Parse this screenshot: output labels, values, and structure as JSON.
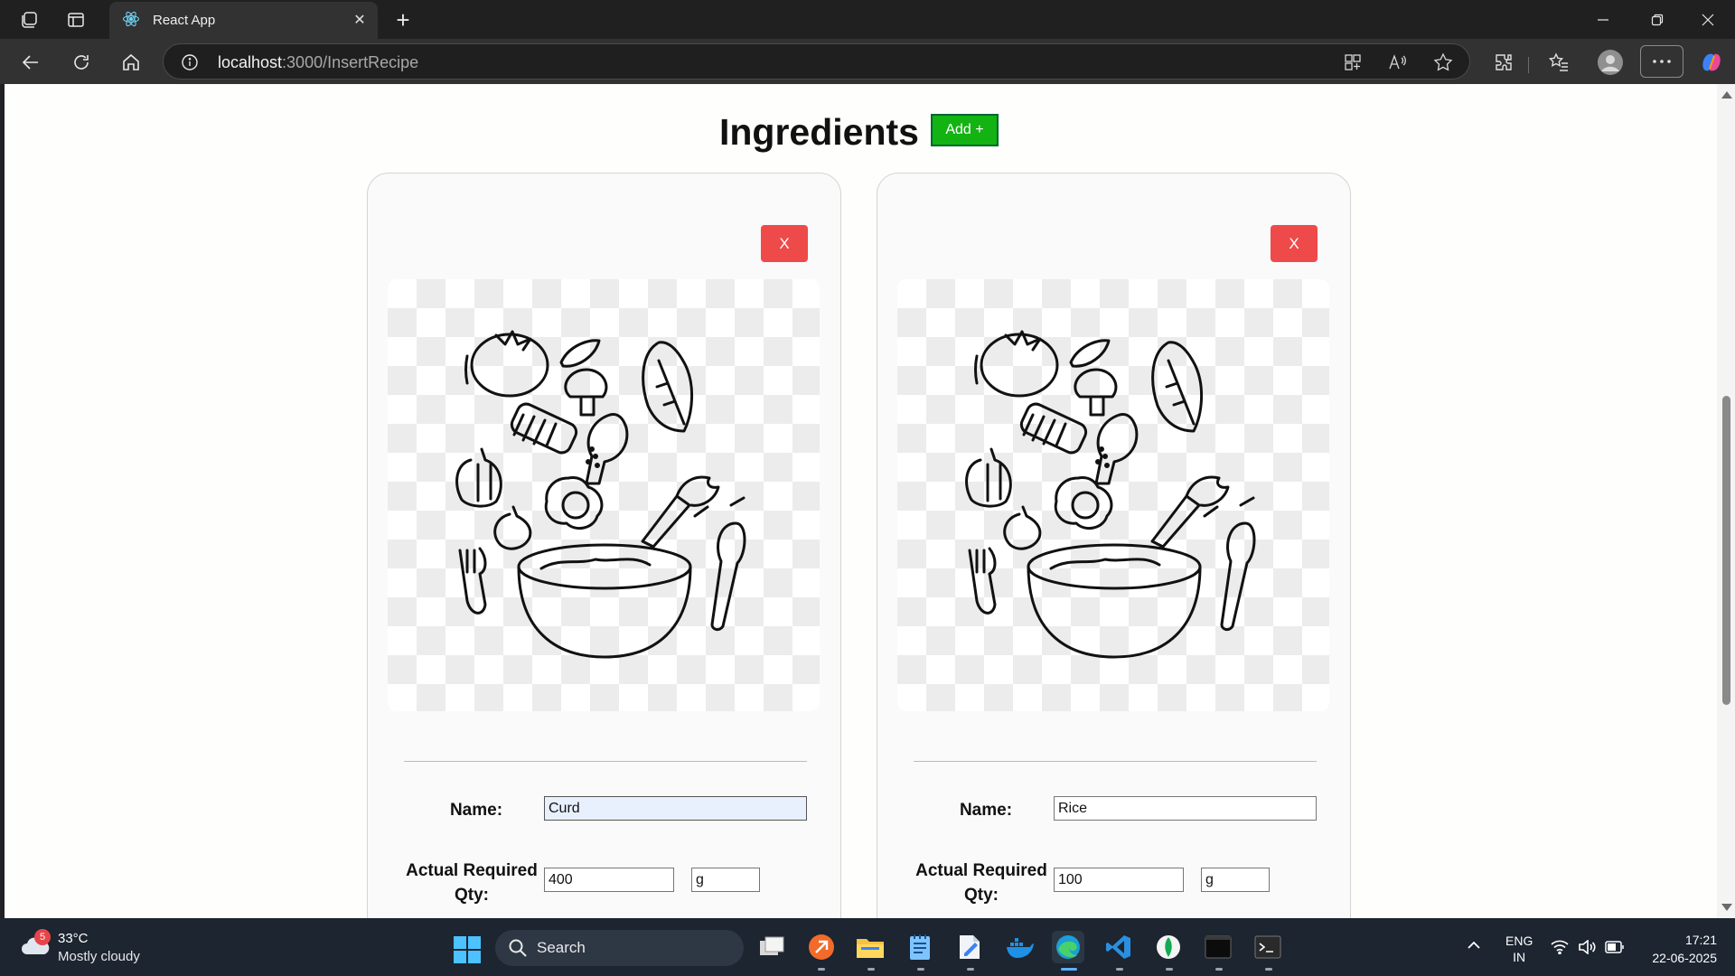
{
  "browser": {
    "tab_title": "React App",
    "url_host": "localhost",
    "url_path": ":3000/InsertRecipe"
  },
  "page": {
    "title": "Ingredients",
    "add_button_label": "Add +",
    "cards": [
      {
        "remove_label": "X",
        "name_label": "Name:",
        "name_value": "Curd",
        "qty_label_line1": "Actual Required",
        "qty_label_line2": "Qty:",
        "qty_value": "400",
        "unit_value": "g"
      },
      {
        "remove_label": "X",
        "name_label": "Name:",
        "name_value": "Rice",
        "qty_label_line1": "Actual Required",
        "qty_label_line2": "Qty:",
        "qty_value": "100",
        "unit_value": "g"
      }
    ]
  },
  "taskbar": {
    "weather_badge": "5",
    "weather_temp": "33°C",
    "weather_condition": "Mostly cloudy",
    "search_label": "Search",
    "lang_line1": "ENG",
    "lang_line2": "IN",
    "time": "17:21",
    "date": "22-06-2025"
  },
  "colors": {
    "add_button": "#12b312",
    "remove_button": "#ee4a4a",
    "card_background": "#fafafa",
    "page_background": "#fefefc"
  }
}
